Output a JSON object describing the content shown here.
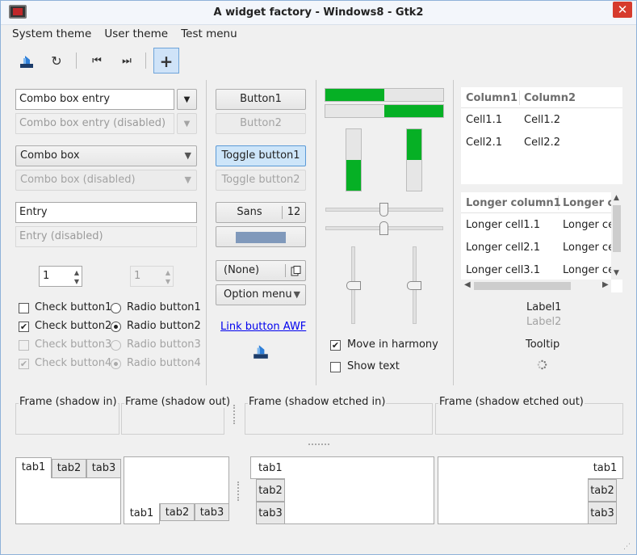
{
  "window": {
    "title": "A widget factory - Windows8 - Gtk2",
    "close_glyph": "✕"
  },
  "menu": [
    "System theme",
    "User theme",
    "Test menu"
  ],
  "toolbar": {
    "icons": [
      "app-icon",
      "refresh-icon",
      "go-first-icon",
      "go-last-icon",
      "add-icon"
    ],
    "glyphs": {
      "refresh": "↻",
      "first": "⏮",
      "last": "⏭",
      "add": "+"
    }
  },
  "left": {
    "combo_entry": "Combo box entry",
    "combo_entry_disabled": "Combo box entry (disabled)",
    "combo": "Combo box",
    "combo_disabled": "Combo box (disabled)",
    "entry": "Entry",
    "entry_disabled": "Entry (disabled)",
    "spin_value": "1",
    "spin_disabled_value": "1",
    "checks": [
      {
        "label": "Check button1",
        "checked": false,
        "disabled": false
      },
      {
        "label": "Check button2",
        "checked": true,
        "disabled": false
      },
      {
        "label": "Check button3",
        "checked": false,
        "disabled": true
      },
      {
        "label": "Check button4",
        "checked": true,
        "disabled": true
      }
    ],
    "radios": [
      {
        "label": "Radio button1",
        "selected": false,
        "disabled": false
      },
      {
        "label": "Radio button2",
        "selected": true,
        "disabled": false
      },
      {
        "label": "Radio button3",
        "selected": false,
        "disabled": true
      },
      {
        "label": "Radio button4",
        "selected": true,
        "disabled": true
      }
    ],
    "check_glyph": "✔"
  },
  "buttons": {
    "button1": "Button1",
    "button2": "Button2",
    "toggle1": "Toggle button1",
    "toggle2": "Toggle button2",
    "font_name": "Sans",
    "font_size": "12",
    "color_swatch": "#8099bb",
    "file_chooser": "(None)",
    "option_menu": "Option menu",
    "link": "Link button AWF"
  },
  "progress": {
    "h1_fraction": 0.5,
    "h2_fraction": 0.5,
    "v1_fraction": 0.5,
    "v2_fraction": 0.5,
    "move_in_harmony": "Move in harmony",
    "move_in_harmony_checked": true,
    "show_text": "Show text",
    "show_text_checked": false
  },
  "tree1": {
    "columns": [
      "Column1",
      "Column2"
    ],
    "rows": [
      [
        "Cell1.1",
        "Cell1.2"
      ],
      [
        "Cell2.1",
        "Cell2.2"
      ]
    ]
  },
  "tree2": {
    "columns": [
      "Longer column1",
      "Longer co"
    ],
    "rows": [
      [
        "Longer cell1.1",
        "Longer ce"
      ],
      [
        "Longer cell2.1",
        "Longer ce"
      ],
      [
        "Longer cell3.1",
        "Longer ce"
      ]
    ]
  },
  "labels": {
    "label1": "Label1",
    "label2": "Label2",
    "tooltip": "Tooltip"
  },
  "frames": [
    "Frame (shadow in)",
    "Frame (shadow out)",
    "Frame (shadow etched in)",
    "Frame (shadow etched out)"
  ],
  "notebooks": {
    "tabs": [
      "tab1",
      "tab2",
      "tab3"
    ]
  },
  "colors": {
    "accent": "#06b025",
    "link": "#0000ee",
    "selection": "#cde5f9"
  }
}
